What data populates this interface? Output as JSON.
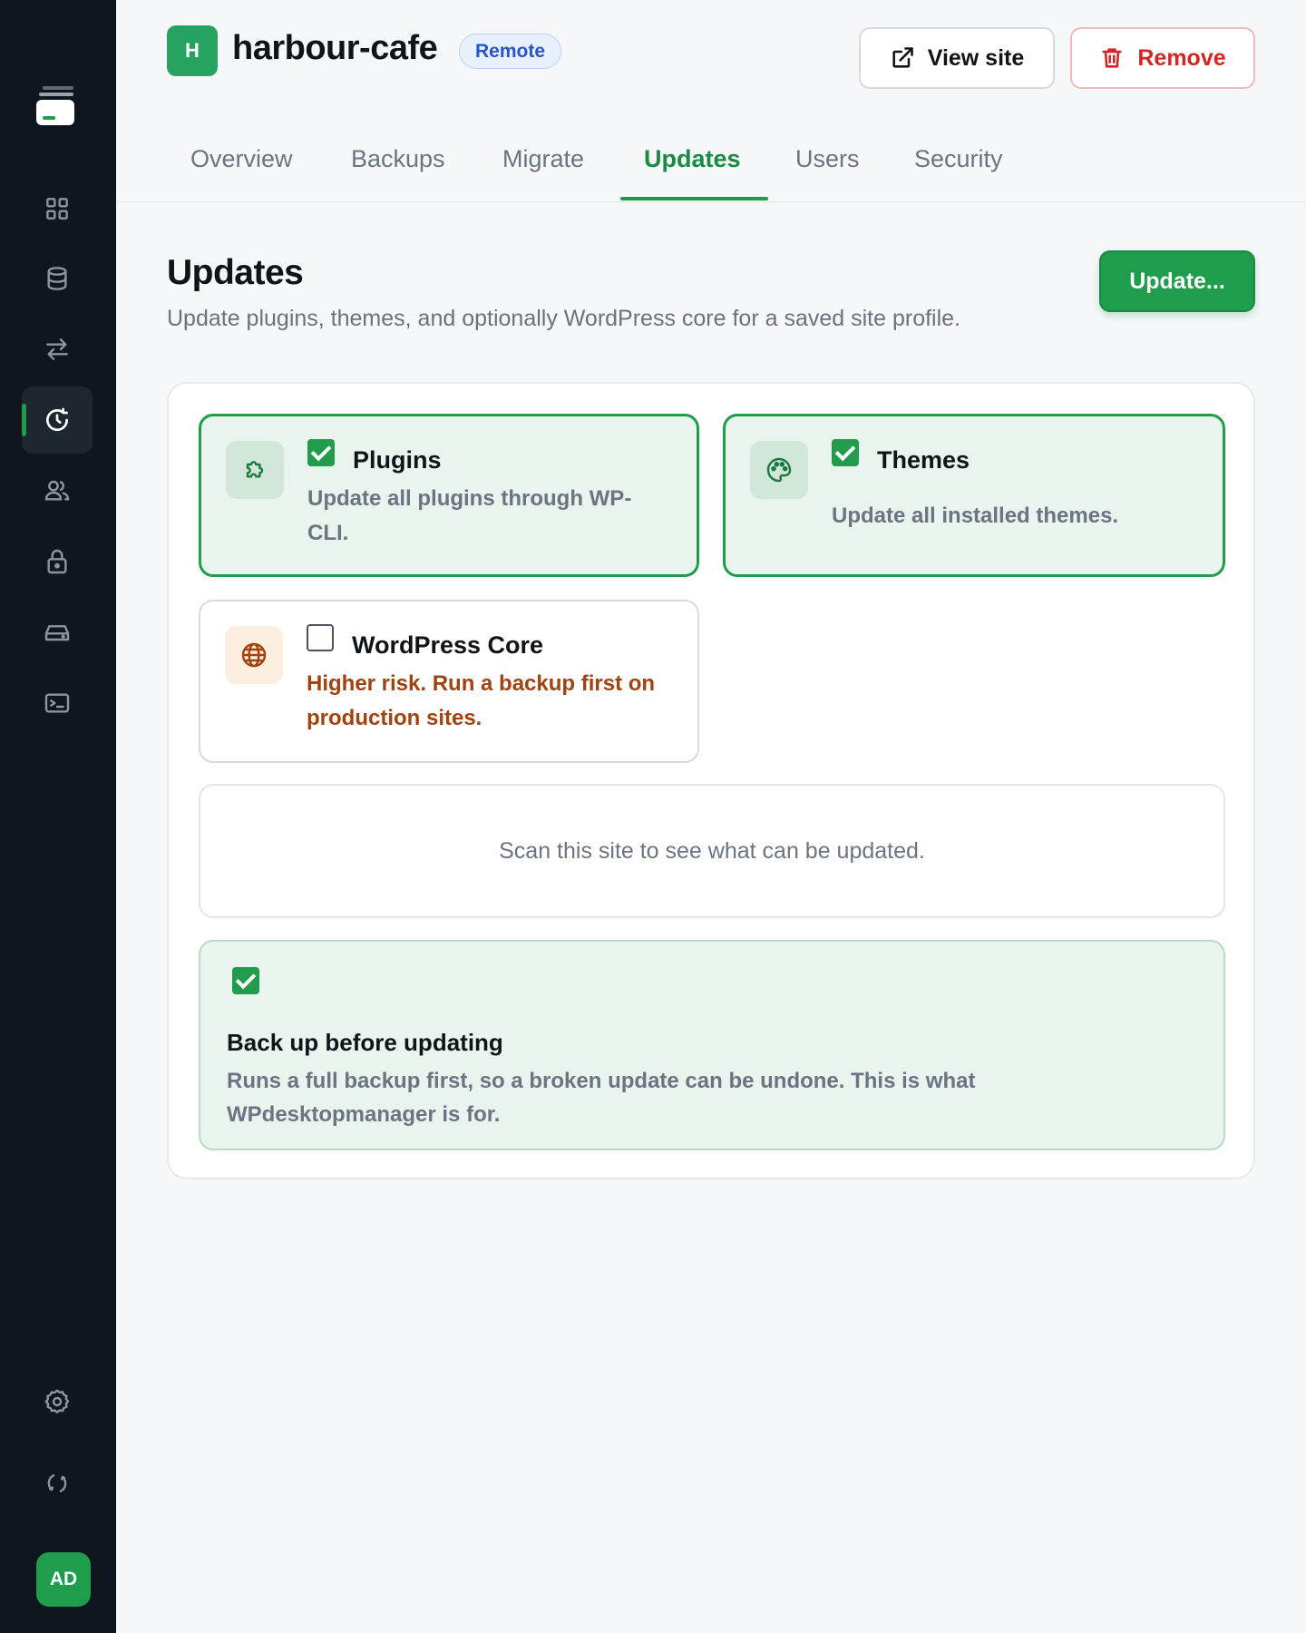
{
  "sidebar": {
    "items": [
      {
        "icon": "grid-icon",
        "label": "Dashboard"
      },
      {
        "icon": "database-icon",
        "label": "Databases"
      },
      {
        "icon": "transfer-icon",
        "label": "Migrate"
      },
      {
        "icon": "refresh-clock-icon",
        "label": "Updates",
        "active": true
      },
      {
        "icon": "users-icon",
        "label": "Users"
      },
      {
        "icon": "lock-icon",
        "label": "Security"
      },
      {
        "icon": "drive-icon",
        "label": "Storage"
      },
      {
        "icon": "terminal-icon",
        "label": "Terminal"
      },
      {
        "icon": "gear-icon",
        "label": "Settings"
      },
      {
        "icon": "sync-icon",
        "label": "Sync"
      }
    ],
    "avatar_initials": "AD"
  },
  "header": {
    "site_initial": "H",
    "site_name": "harbour-cafe",
    "site_type": "Remote",
    "view_site_label": "View site",
    "remove_label": "Remove"
  },
  "tabs": [
    {
      "label": "Overview"
    },
    {
      "label": "Backups"
    },
    {
      "label": "Migrate"
    },
    {
      "label": "Updates",
      "active": true
    },
    {
      "label": "Users"
    },
    {
      "label": "Security"
    }
  ],
  "page": {
    "title": "Updates",
    "subtitle": "Update plugins, themes, and optionally WordPress core for a saved site profile.",
    "update_button": "Update..."
  },
  "options": {
    "plugins": {
      "title": "Plugins",
      "description": "Update all plugins through WP-CLI.",
      "checked": true,
      "icon": "puzzle-icon"
    },
    "themes": {
      "title": "Themes",
      "description": "Update all installed themes.",
      "checked": true,
      "icon": "palette-icon"
    },
    "core": {
      "title": "WordPress Core",
      "description": "Higher risk. Run a backup first on production sites.",
      "checked": false,
      "icon": "globe-icon"
    }
  },
  "scan_message": "Scan this site to see what can be updated.",
  "backup": {
    "checked": true,
    "title": "Back up before updating",
    "description": "Runs a full backup first, so a broken update can be undone. This is what WPdesktopmanager is for."
  },
  "colors": {
    "accent": "#1f9d4c",
    "sidebar": "#0f161d",
    "danger": "#d42525",
    "warning": "#a14310",
    "remote": "#2955c8"
  }
}
